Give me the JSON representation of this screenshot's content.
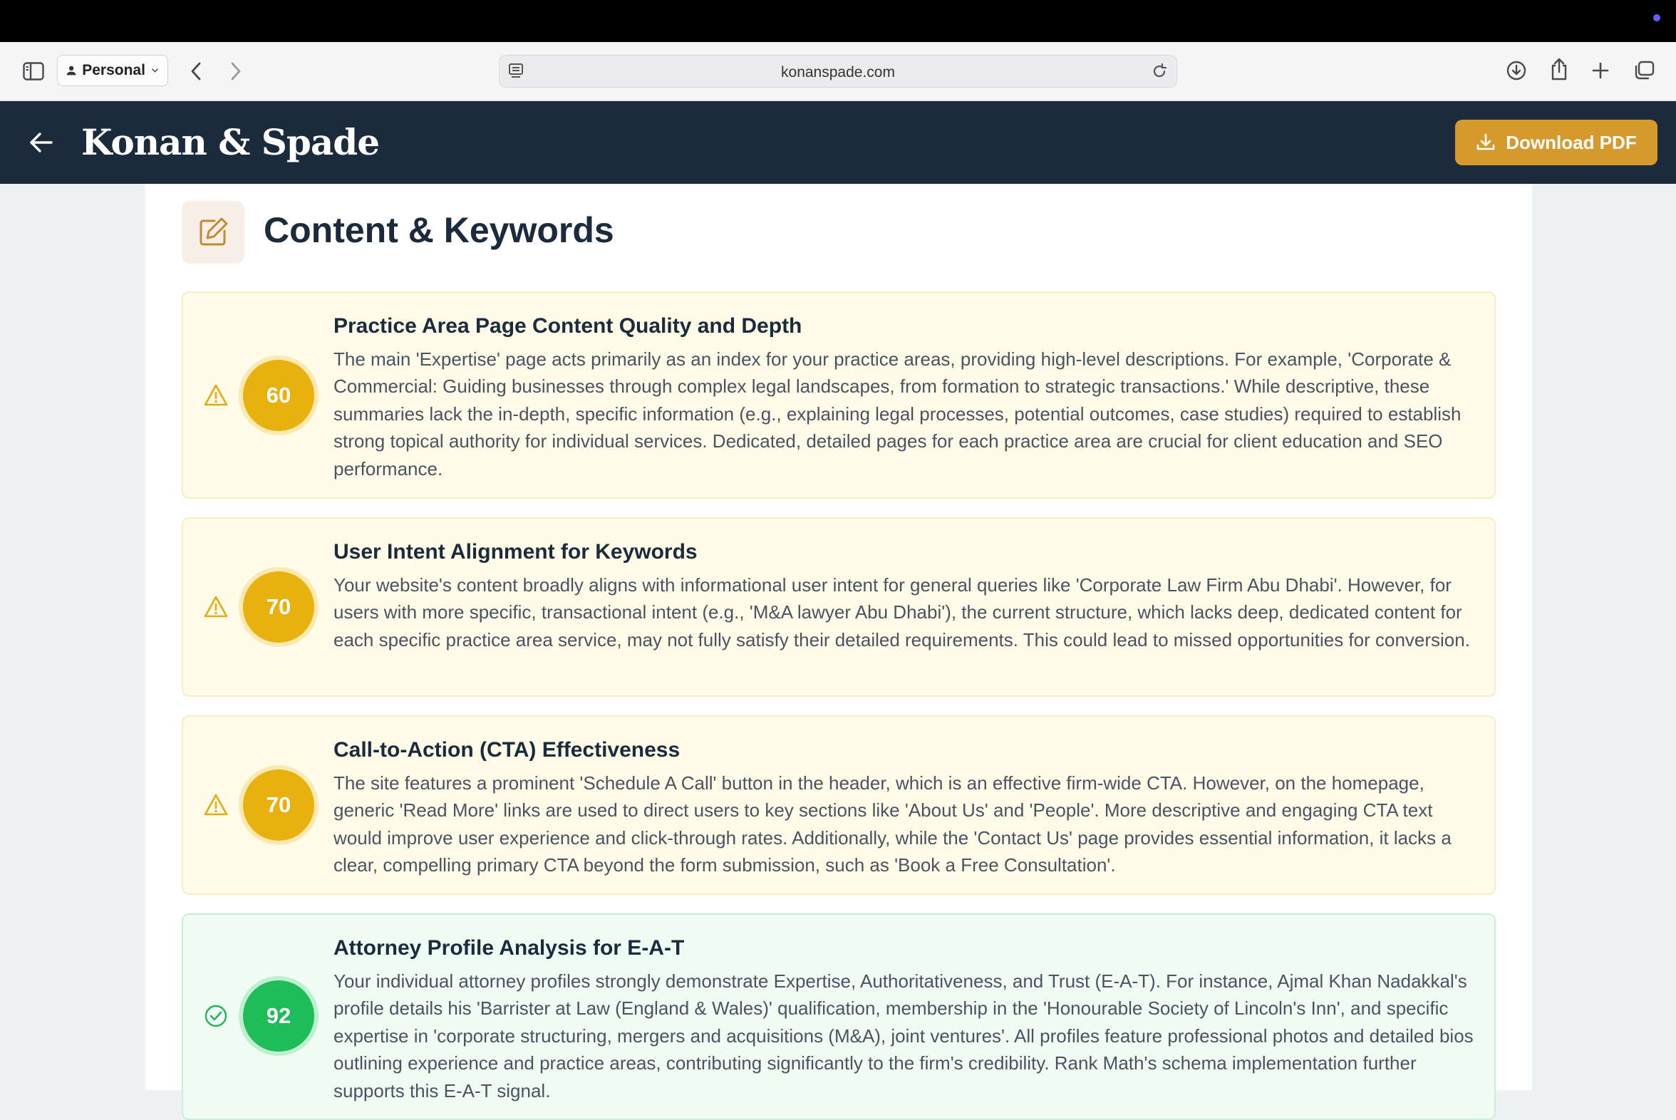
{
  "browser": {
    "profile_label": "Personal",
    "url": "konanspade.com"
  },
  "app": {
    "brand": "Konan & Spade",
    "download_label": "Download PDF"
  },
  "section": {
    "title": "Content & Keywords"
  },
  "items": [
    {
      "status": "warning",
      "score": "60",
      "title": "Practice Area Page Content Quality and Depth",
      "description": "The main 'Expertise' page acts primarily as an index for your practice areas, providing high-level descriptions. For example, 'Corporate & Commercial: Guiding businesses through complex legal landscapes, from formation to strategic transactions.' While descriptive, these summaries lack the in-depth, specific information (e.g., explaining legal processes, potential outcomes, case studies) required to establish strong topical authority for individual services. Dedicated, detailed pages for each practice area are crucial for client education and SEO performance."
    },
    {
      "status": "warning",
      "score": "70",
      "title": "User Intent Alignment for Keywords",
      "description": "Your website's content broadly aligns with informational user intent for general queries like 'Corporate Law Firm Abu Dhabi'. However, for users with more specific, transactional intent (e.g., 'M&A lawyer Abu Dhabi'), the current structure, which lacks deep, dedicated content for each specific practice area service, may not fully satisfy their detailed requirements. This could lead to missed opportunities for conversion."
    },
    {
      "status": "warning",
      "score": "70",
      "title": "Call-to-Action (CTA) Effectiveness",
      "description": "The site features a prominent 'Schedule A Call' button in the header, which is an effective firm-wide CTA. However, on the homepage, generic 'Read More' links are used to direct users to key sections like 'About Us' and 'People'. More descriptive and engaging CTA text would improve user experience and click-through rates. Additionally, while the 'Contact Us' page provides essential information, it lacks a clear, compelling primary CTA beyond the form submission, such as 'Book a Free Consultation'."
    },
    {
      "status": "good",
      "score": "92",
      "title": "Attorney Profile Analysis for E-A-T",
      "description": "Your individual attorney profiles strongly demonstrate Expertise, Authoritativeness, and Trust (E-A-T). For instance, Ajmal Khan Nadakkal's profile details his 'Barrister at Law (England & Wales)' qualification, membership in the 'Honourable Society of Lincoln's Inn', and specific expertise in 'corporate structuring, mergers and acquisitions (M&A), joint ventures'. All profiles feature professional photos and detailed bios outlining experience and practice areas, contributing significantly to the firm's credibility. Rank Math's schema implementation further supports this E-A-T signal."
    }
  ],
  "colors": {
    "appbar": "#1b2b3c",
    "accent": "#d49a2e",
    "warning": "#e8b10f",
    "good": "#1fbd5a"
  },
  "icons": {
    "section": "edit-icon",
    "warning": "warning-triangle-icon",
    "good": "check-circle-icon"
  }
}
